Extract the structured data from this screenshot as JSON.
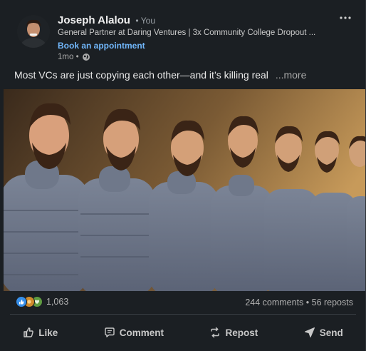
{
  "author": {
    "name": "Joseph Alalou",
    "badge": "• You",
    "headline": "General Partner at Daring Ventures | 3x Community College Dropout ...",
    "cta": "Book an appointment",
    "timestamp": "1mo •",
    "visibility_icon": "globe-icon",
    "more_icon": "more-horizontal-icon"
  },
  "post": {
    "text": "Most VCs are just copying each other—and it’s killing real",
    "see_more": "...more"
  },
  "social": {
    "reaction_icons": [
      "like-icon",
      "celebrate-icon",
      "support-icon"
    ],
    "reaction_count": "1,063",
    "comments_reposts": "244 comments • 56 reposts"
  },
  "actions": {
    "like": "Like",
    "comment": "Comment",
    "repost": "Repost",
    "send": "Send"
  },
  "colors": {
    "background": "#1b1f23",
    "link": "#71b7fb",
    "text": "#e9e9e9",
    "muted": "#a9a9a9"
  }
}
